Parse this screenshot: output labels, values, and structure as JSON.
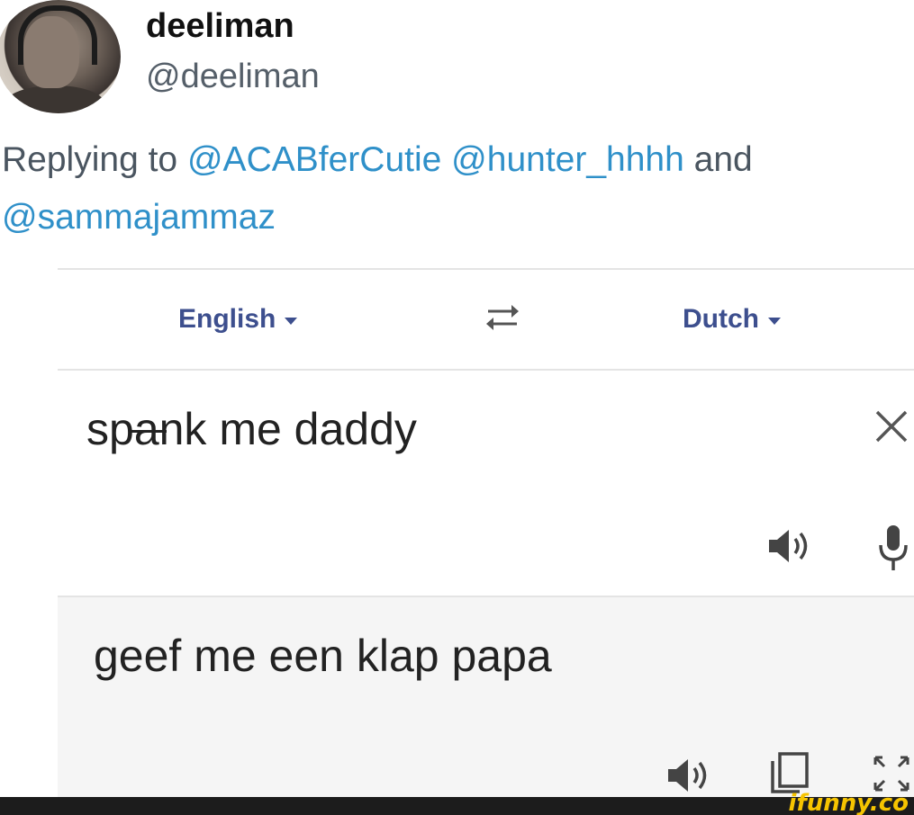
{
  "tweet": {
    "display_name": "deeliman",
    "handle": "@deeliman",
    "reply_prefix": "Replying to",
    "mention_1": "@ACABferCutie",
    "mention_2": "@hunter_hhhh",
    "conjunction": "and",
    "mention_3": "@sammajammaz"
  },
  "translate": {
    "source_language": "English",
    "target_language": "Dutch",
    "source_text_prefix": "sp",
    "source_text_struck": "a",
    "source_text_suffix": "nk me daddy",
    "result_text": "geef me een klap papa"
  },
  "icons": {
    "swap": "swap-arrows-icon",
    "clear": "close-icon",
    "listen_source": "speaker-icon",
    "voice_input": "microphone-icon",
    "listen_result": "speaker-icon",
    "copy": "copy-icon",
    "fullscreen": "expand-icon"
  },
  "colors": {
    "mention": "#2f90c9",
    "language_label": "#3d4f8e",
    "watermark": "#f6c400"
  },
  "watermark": "ifunny.co"
}
